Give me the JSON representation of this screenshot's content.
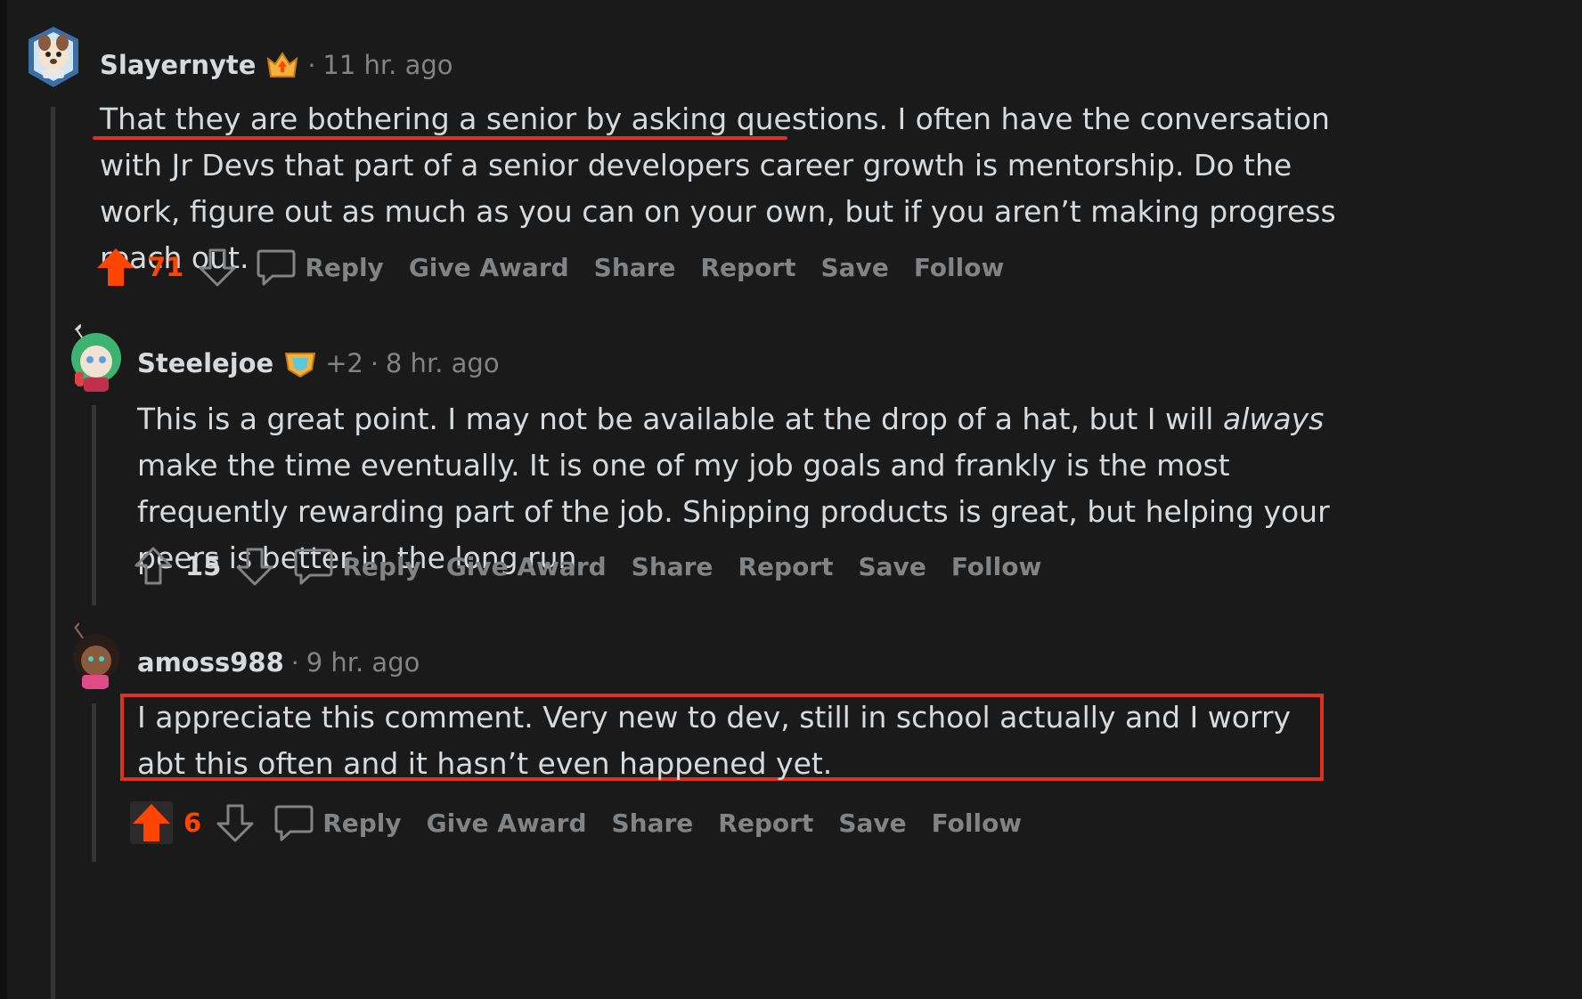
{
  "colors": {
    "background": "#1a1a1b",
    "upvote": "#ff4500",
    "muted": "#818384",
    "text": "#d7dadc",
    "annotation": "#e0301e"
  },
  "comments": [
    {
      "username": "Slayernyte",
      "flair_icon": "flair-badge-icon",
      "separator": "·",
      "time": "11 hr. ago",
      "body_part1": "That they are bothering a senior by asking questions.",
      "body_part2": " I often have the conversation with Jr Devs that part of a senior developers career growth is mentorship. Do the work, figure out as much as you can on your own, but if you aren’t making progress reach out.",
      "score": "71",
      "vote_state": "upvoted",
      "actions": {
        "reply": "Reply",
        "give_award": "Give Award",
        "share": "Share",
        "report": "Report",
        "save": "Save",
        "follow": "Follow"
      }
    },
    {
      "username": "Steelejoe",
      "flair_icon": "flair-badge-icon",
      "extra_awards": "+2",
      "separator": "·",
      "time": "8 hr. ago",
      "body_part1": "This is a great point. I may not be available at the drop of a hat, but I will ",
      "body_em": "always",
      "body_part2": " make the time eventually. It is one of my job goals and frankly is the most frequently rewarding part of the job. Shipping products is great, but helping your peers is better in the long run.",
      "score": "15",
      "vote_state": "none",
      "actions": {
        "reply": "Reply",
        "give_award": "Give Award",
        "share": "Share",
        "report": "Report",
        "save": "Save",
        "follow": "Follow"
      }
    },
    {
      "username": "amoss988",
      "separator": "·",
      "time": "9 hr. ago",
      "body": "I appreciate this comment. Very new to dev, still in school actually and I worry abt this often and it hasn’t even happened yet.",
      "score": "6",
      "vote_state": "upvoted",
      "actions": {
        "reply": "Reply",
        "give_award": "Give Award",
        "share": "Share",
        "report": "Report",
        "save": "Save",
        "follow": "Follow"
      }
    }
  ]
}
